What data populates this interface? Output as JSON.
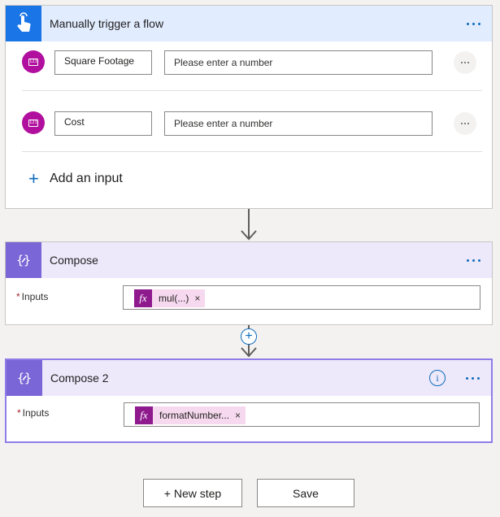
{
  "trigger": {
    "title": "Manually trigger a flow",
    "icon": "touch-trigger-icon",
    "inputs": [
      {
        "name": "Square Footage",
        "placeholder": "Please enter a number"
      },
      {
        "name": "Cost",
        "placeholder": "Please enter a number"
      }
    ],
    "add_input_label": "Add an input"
  },
  "compose1": {
    "title": "Compose",
    "field_label": "Inputs",
    "required_mark": "*",
    "token": "mul(...)"
  },
  "compose2": {
    "title": "Compose 2",
    "field_label": "Inputs",
    "required_mark": "*",
    "token": "formatNumber..."
  },
  "footer": {
    "new_step_label": "+ New step",
    "save_label": "Save"
  },
  "colors": {
    "trigger_header": "#e1ecff",
    "trigger_icon": "#1a75e6",
    "compose_header": "#ede9fb",
    "compose_icon": "#7a66d6",
    "number_icon": "#b10f9e",
    "expression_token": "#f6d9ee",
    "accent": "#0f6cbd"
  }
}
